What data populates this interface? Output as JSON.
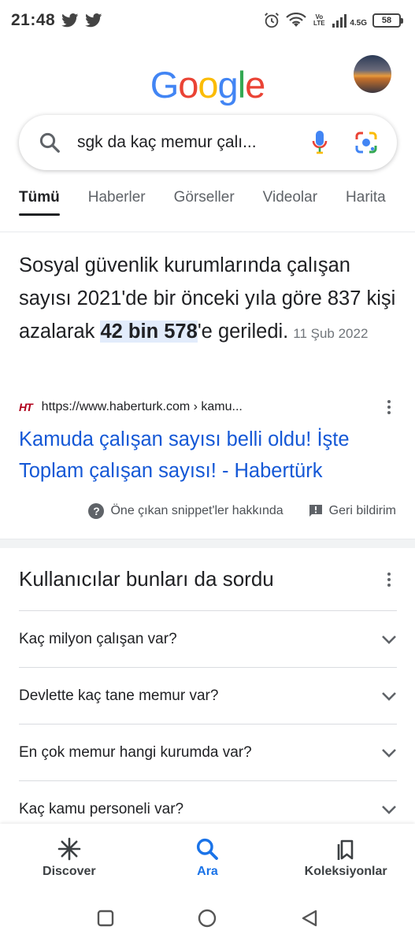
{
  "status_bar": {
    "time": "21:48",
    "network_label": "4.5G",
    "volte_label": "Vo LTE",
    "battery": "58"
  },
  "header": {
    "logo_letters": [
      "G",
      "o",
      "o",
      "g",
      "l",
      "e"
    ],
    "logo_colors": [
      "#4285F4",
      "#EA4335",
      "#FBBC05",
      "#4285F4",
      "#34A853",
      "#EA4335"
    ]
  },
  "search": {
    "query": "sgk da kaç memur çalı..."
  },
  "tabs": [
    {
      "label": "Tümü",
      "active": true
    },
    {
      "label": "Haberler",
      "active": false
    },
    {
      "label": "Görseller",
      "active": false
    },
    {
      "label": "Videolar",
      "active": false
    },
    {
      "label": "Harita",
      "active": false
    }
  ],
  "snippet": {
    "text_before": "Sosyal güvenlik kurumlarında çalışan sayısı 2021'de bir önceki yıla göre 837 kişi azalarak ",
    "highlight": "42 bin 578",
    "text_after": "'e geriledi.",
    "date": "11 Şub 2022",
    "source_logo": "HT",
    "source_url": "https://www.haberturk.com › kamu...",
    "title": "Kamuda çalışan sayısı belli oldu! İşte Toplam çalışan sayısı! - Habertürk",
    "about_label": "Öne çıkan snippet'ler hakkında",
    "feedback_label": "Geri bildirim"
  },
  "people_also_ask": {
    "title": "Kullanıcılar bunları da sordu",
    "questions": [
      "Kaç milyon çalışan var?",
      "Devlette kaç tane memur var?",
      "En çok memur hangi kurumda var?",
      "Kaç kamu personeli var?"
    ]
  },
  "bottom_nav": [
    {
      "label": "Discover",
      "icon": "asterisk-icon",
      "active": false
    },
    {
      "label": "Ara",
      "icon": "search-icon",
      "active": true
    },
    {
      "label": "Koleksiyonlar",
      "icon": "collections-icon",
      "active": false
    }
  ],
  "colors": {
    "accent": "#1a73e8",
    "link": "#1558d6",
    "highlight_bg": "#e2ecfb"
  }
}
